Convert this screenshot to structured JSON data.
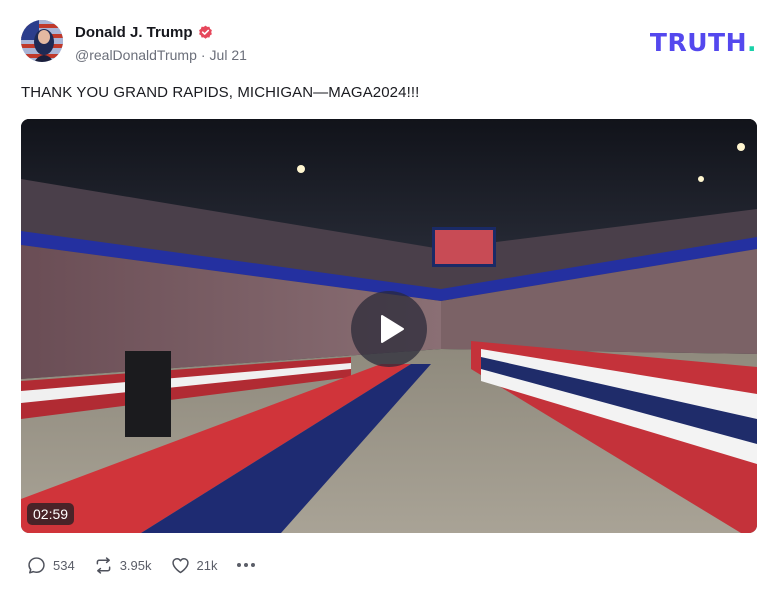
{
  "author": {
    "name": "Donald J. Trump",
    "handle": "@realDonaldTrump",
    "separator": "·",
    "date": "Jul 21",
    "verified_color": "#e6475b"
  },
  "brand": {
    "wordmark": "TRUTH",
    "dot": ".",
    "color": "#5448ee",
    "dot_color": "#19d1a8"
  },
  "post": {
    "text": "THANK YOU GRAND RAPIDS, MICHIGAN—MAGA2024!!!"
  },
  "media": {
    "type": "video",
    "duration": "02:59",
    "play_icon": "play-icon"
  },
  "actions": {
    "replies": "534",
    "retruths": "3.95k",
    "likes": "21k",
    "icons": [
      "reply-icon",
      "retruth-icon",
      "heart-icon",
      "more-icon"
    ]
  }
}
